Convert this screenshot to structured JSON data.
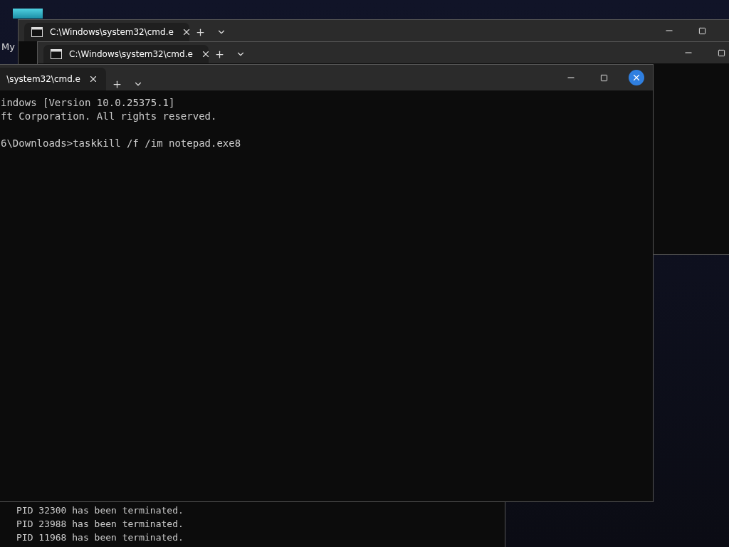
{
  "desktop_icon": {
    "label": "My"
  },
  "back_windows": [
    {
      "tab_title": "C:\\Windows\\system32\\cmd.e"
    },
    {
      "tab_title": "C:\\Windows\\system32\\cmd.e"
    }
  ],
  "front_window": {
    "tab_title": "\\system32\\cmd.e",
    "close_hovered": true,
    "blocks": [
      [
        "indows [Version 10.0.25375.1]",
        "ft Corporation. All rights reserved."
      ],
      [
        "6\\Downloads>taskkill /f /im notepad.exe8"
      ]
    ]
  },
  "lower_window": {
    "lines": [
      "PID 32300 has been terminated.",
      "PID 23988 has been terminated.",
      "PID 11968 has been terminated."
    ]
  }
}
